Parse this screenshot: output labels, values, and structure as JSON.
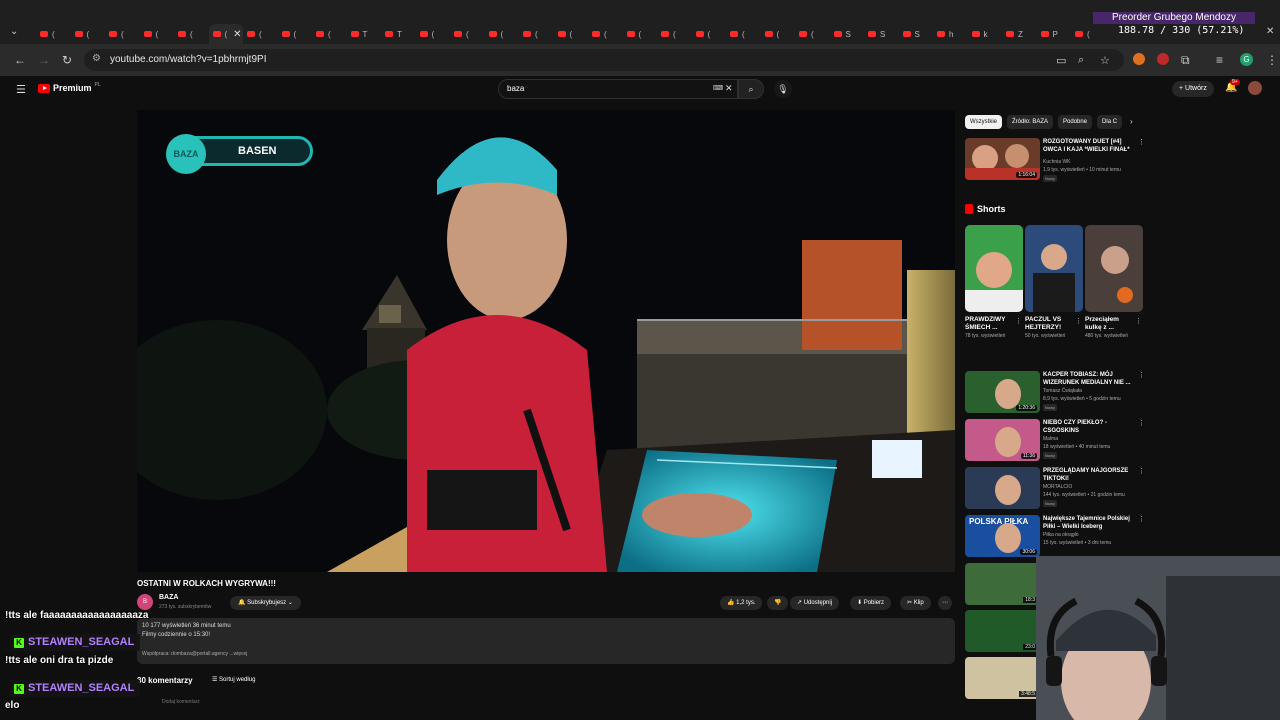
{
  "browser": {
    "tab_letters": [
      "(",
      "(",
      "(",
      "(",
      "(",
      "(",
      "(",
      "(",
      "(",
      "T",
      "T",
      "(",
      "(",
      "(",
      "(",
      "(",
      "(",
      "(",
      "(",
      "(",
      "(",
      "(",
      "(",
      "S",
      "S",
      "S",
      "h",
      "k",
      "Z",
      "P",
      "("
    ],
    "active_tab_index": 5,
    "url": "youtube.com/watch?v=1pbhrmjt9PI"
  },
  "overlay": {
    "banner": "Preorder Grubego Mendozy",
    "counter": "188.78 / 330 (57.21%)"
  },
  "masthead": {
    "logo": "Premium",
    "logo_region": "PL",
    "search_query": "baza",
    "create_label": "Utwórz",
    "notification_count": "9+"
  },
  "video": {
    "badge_logo": "BAZA",
    "badge_label": "BASEN",
    "title": "OSTATNI W ROLKACH WYGRYWA!!!",
    "channel": "BAZA",
    "subscribers": "273 tys. subskrybentów",
    "subscribe_label": "Subskrybujesz",
    "likes": "1,2 tys.",
    "share_label": "Udostępnij",
    "download_label": "Pobierz",
    "clip_label": "Klip",
    "desc_line1": "10 177 wyświetleń  36 minut temu",
    "desc_line2": "Filmy codziennie o 15:30!",
    "desc_line3": "Współpraca: dombaza@portall.agency  ...więcej",
    "comments_count": "30 komentarzy",
    "sort_label": "Sortuj według",
    "add_comment": "Dodaj komentarz"
  },
  "chat": {
    "messages": [
      {
        "type": "text",
        "text": "!tts ale faaaaaaaaaaaaaaaaaza"
      },
      {
        "type": "user",
        "text": "STEAWEN_SEAGAL"
      },
      {
        "type": "text",
        "text": "!tts ale oni dra ta pizde"
      },
      {
        "type": "user",
        "text": "STEAWEN_SEAGAL"
      },
      {
        "type": "text",
        "text": "elo"
      }
    ]
  },
  "sidebar": {
    "chips": [
      "Wszystkie",
      "Źródło: BAZA",
      "Podobne",
      "Dla C"
    ],
    "top_rec": {
      "title": "ROZGOTOWANY DUET [#4] OWCA I KAJA *WIELKI FINAŁ*",
      "channel": "Kuchnia WK",
      "meta": "1,9 tys. wyświetleń • 10 minut temu",
      "badge": "Nowy",
      "duration": "1:16:04"
    },
    "shorts_title": "Shorts",
    "shorts": [
      {
        "title": "PRAWDZIWY ŚMIECH ...",
        "views": "78 tys. wyświetleń"
      },
      {
        "title": "PACZUL VS HEJTERZY!",
        "views": "50 tys. wyświetleń"
      },
      {
        "title": "Przeciąłem kulkę z ...",
        "views": "480 tys. wyświetleń"
      }
    ],
    "recs": [
      {
        "title": "KACPER TOBIASZ: MÓJ WIZERUNEK MEDIALNY NIE ...",
        "channel": "Tomasz Ćwiąkała",
        "meta": "8,9 tys. wyświetleń • 5 godzin temu",
        "badge": "Nowy",
        "duration": "1:20:36"
      },
      {
        "title": "NIEBO CZY PIEKŁO? - CSGOSKINS",
        "channel": "Malma",
        "meta": "18 wyświetleń • 40 minut temu",
        "badge": "Nowy",
        "duration": "11:36"
      },
      {
        "title": "PRZEGLĄDAMY NAJGORSZE TIKTOKI!",
        "channel": "MORTALCIO",
        "meta": "144 tys. wyświetleń • 21 godzin temu",
        "badge": "Nowy",
        "duration": ""
      },
      {
        "title": "Największe Tajemnice Polskiej Piłki – Wielki Iceberg",
        "channel": "Piłka na okrągło",
        "meta": "15 tys. wyświetleń • 3 dni temu",
        "badge": "",
        "duration": "30:06",
        "thumb_text": "POLSKA PIŁKA"
      }
    ],
    "extra_durations": [
      "18:3",
      "23:0",
      "3:48:5"
    ]
  },
  "colors": {
    "bg": "#0f0f0f",
    "yt_red": "#ff0000",
    "chat_name": "#b480ff",
    "kick_green": "#53fc18",
    "teal": "#29c2bb"
  }
}
